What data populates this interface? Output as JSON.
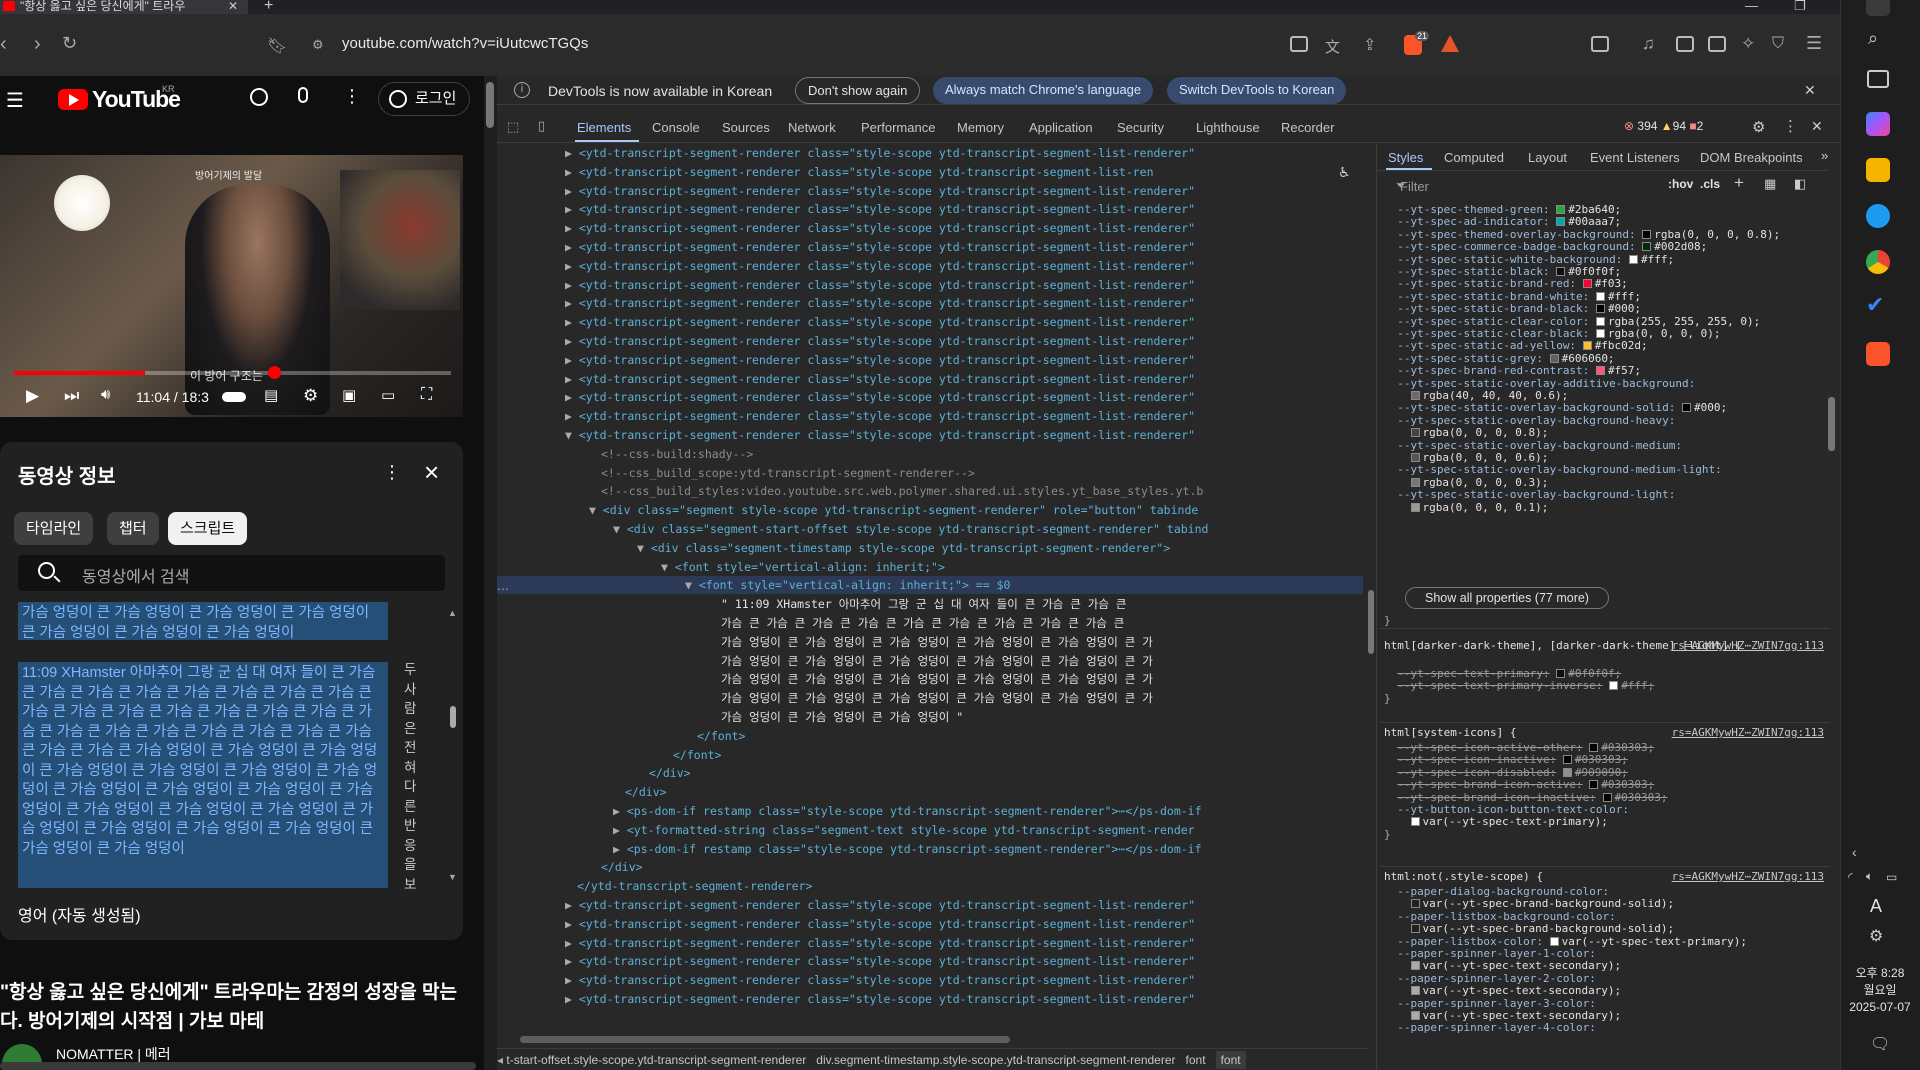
{
  "browser": {
    "tab_title": "\"항상 옳고 싶은 당신에게\" 트라우",
    "url": "youtube.com/watch?v=iUutcwcTGQs",
    "ext_badge": "21"
  },
  "youtube": {
    "logo_text": "YouTube",
    "logo_region": "KR",
    "login_label": "로그인",
    "video_overlay_text": "방어기제의 발달",
    "video_caption": "이 방어 구조는",
    "current_time": "11:04 / 18:3",
    "progress_fraction": 0.6,
    "panel_title": "동영상 정보",
    "chips": [
      "타임라인",
      "챕터",
      "스크립트"
    ],
    "selected_chip": "스크립트",
    "search_placeholder": "동영상에서 검색",
    "segment1_text": "가슴 엉덩이 큰 가슴 엉덩이 큰 가슴 엉덩이 큰 가슴 엉덩이 큰 가슴 엉덩이 큰 가슴 엉덩이 큰 가슴 엉덩이",
    "segment2_text": "11:09 XHamster 아마추어 그랑 군 십 대 여자 들이 큰 가슴 큰 가슴 큰 가슴 큰 가슴 큰 가슴 큰 가슴 큰 가슴 큰 가슴 큰 가슴 큰 가슴 큰 가슴 큰 가슴 큰 가슴 큰 가슴 큰 가슴 큰 가슴 큰 가슴 큰 가슴 큰 가슴 큰 가슴 큰 가슴 큰 가슴 큰 가슴 큰 가슴 큰 가슴 큰 가슴 엉덩이 큰 가슴 엉덩이 큰 가슴 엉덩이 큰 가슴 엉덩이 큰 가슴 엉덩이 큰 가슴 엉덩이 큰 가슴 엉덩이 큰 가슴 엉덩이 큰 가슴 엉덩이 큰 가슴 엉덩이 큰 가슴 엉덩이 큰 가슴 엉덩이 큰 가슴 엉덩이 큰 가슴 엉덩이 큰 가슴 엉덩이 큰 가슴 엉덩이 큰 가슴 엉덩이 큰 가슴 엉덩이 큰 가슴 엉덩이 큰 가슴 엉덩이",
    "vertical_text": "두사람은전혀다른반응을보",
    "language_label": "영어 (자동 생성됨)",
    "video_title": "\"항상 옳고 싶은 당신에게\" 트라우마는 감정의 성장을 막는다. 방어기제의 시작점 | 가보 마테",
    "channel_name": "NOMATTER | 메러"
  },
  "devtools": {
    "banner_text": "DevTools is now available in Korean",
    "banner_buttons": [
      "Don't show again",
      "Always match Chrome's language",
      "Switch DevTools to Korean"
    ],
    "tabs": [
      "Elements",
      "Console",
      "Sources",
      "Network",
      "Performance",
      "Memory",
      "Application",
      "Security",
      "Lighthouse",
      "Recorder"
    ],
    "selected_tab": "Elements",
    "error_count": "394",
    "warning_count": "94",
    "issue_count": "2",
    "tree_lines": [
      {
        "indent": 34,
        "caret": "▶",
        "type": "tag",
        "text": "<ytd-transcript-segment-renderer class=\"style-scope ytd-transcript-segment-list-renderer\""
      },
      {
        "indent": 34,
        "caret": "▶",
        "type": "tag",
        "text": "<ytd-transcript-segment-renderer class=\"style-scope ytd-transcript-segment-list-ren"
      },
      {
        "indent": 34,
        "caret": "▶",
        "type": "tag",
        "text": "<ytd-transcript-segment-renderer class=\"style-scope ytd-transcript-segment-list-renderer\""
      },
      {
        "indent": 34,
        "caret": "▶",
        "type": "tag",
        "text": "<ytd-transcript-segment-renderer class=\"style-scope ytd-transcript-segment-list-renderer\""
      },
      {
        "indent": 34,
        "caret": "▶",
        "type": "tag",
        "text": "<ytd-transcript-segment-renderer class=\"style-scope ytd-transcript-segment-list-renderer\""
      },
      {
        "indent": 34,
        "caret": "▶",
        "type": "tag",
        "text": "<ytd-transcript-segment-renderer class=\"style-scope ytd-transcript-segment-list-renderer\""
      },
      {
        "indent": 34,
        "caret": "▶",
        "type": "tag",
        "text": "<ytd-transcript-segment-renderer class=\"style-scope ytd-transcript-segment-list-renderer\""
      },
      {
        "indent": 34,
        "caret": "▶",
        "type": "tag",
        "text": "<ytd-transcript-segment-renderer class=\"style-scope ytd-transcript-segment-list-renderer\""
      },
      {
        "indent": 34,
        "caret": "▶",
        "type": "tag",
        "text": "<ytd-transcript-segment-renderer class=\"style-scope ytd-transcript-segment-list-renderer\""
      },
      {
        "indent": 34,
        "caret": "▶",
        "type": "tag",
        "text": "<ytd-transcript-segment-renderer class=\"style-scope ytd-transcript-segment-list-renderer\""
      },
      {
        "indent": 34,
        "caret": "▶",
        "type": "tag",
        "text": "<ytd-transcript-segment-renderer class=\"style-scope ytd-transcript-segment-list-renderer\""
      },
      {
        "indent": 34,
        "caret": "▶",
        "type": "tag",
        "text": "<ytd-transcript-segment-renderer class=\"style-scope ytd-transcript-segment-list-renderer\""
      },
      {
        "indent": 34,
        "caret": "▶",
        "type": "tag",
        "text": "<ytd-transcript-segment-renderer class=\"style-scope ytd-transcript-segment-list-renderer\""
      },
      {
        "indent": 34,
        "caret": "▶",
        "type": "tag",
        "text": "<ytd-transcript-segment-renderer class=\"style-scope ytd-transcript-segment-list-renderer\""
      },
      {
        "indent": 34,
        "caret": "▶",
        "type": "tag",
        "text": "<ytd-transcript-segment-renderer class=\"style-scope ytd-transcript-segment-list-renderer\""
      },
      {
        "indent": 34,
        "caret": "▼",
        "type": "tag",
        "text": "<ytd-transcript-segment-renderer class=\"style-scope ytd-transcript-segment-list-renderer\""
      },
      {
        "indent": 52,
        "caret": "",
        "type": "cm",
        "text": "<!--css-build:shady-->"
      },
      {
        "indent": 52,
        "caret": "",
        "type": "cm",
        "text": "<!--css_build_scope:ytd-transcript-segment-renderer-->"
      },
      {
        "indent": 52,
        "caret": "",
        "type": "cm",
        "text": "<!--css_build_styles:video.youtube.src.web.polymer.shared.ui.styles.yt_base_styles.yt.b"
      },
      {
        "indent": 46,
        "caret": "▼",
        "type": "tag",
        "text": "<div class=\"segment style-scope ytd-transcript-segment-renderer\" role=\"button\" tabinde"
      },
      {
        "indent": 58,
        "caret": "▼",
        "type": "tag",
        "text": "<div class=\"segment-start-offset style-scope ytd-transcript-segment-renderer\" tabind"
      },
      {
        "indent": 70,
        "caret": "▼",
        "type": "tag",
        "text": "<div class=\"segment-timestamp style-scope ytd-transcript-segment-renderer\">"
      },
      {
        "indent": 82,
        "caret": "▼",
        "type": "tag",
        "text": "<font style=\"vertical-align: inherit;\">"
      },
      {
        "indent": 94,
        "caret": "▼",
        "type": "tag",
        "text": "<font style=\"vertical-align: inherit;\"> == $0",
        "hl": true
      },
      {
        "indent": 112,
        "caret": "",
        "type": "tx",
        "text": "\" 11:09 XHamster 아마추어 그랑 군 십 대 여자 들이 큰 가슴 큰 가슴 큰"
      },
      {
        "indent": 112,
        "caret": "",
        "type": "tx",
        "text": "가슴 큰 가슴 큰 가슴 큰 가슴 큰 가슴 큰 가슴 큰 가슴 큰 가슴 큰 가슴 큰"
      },
      {
        "indent": 112,
        "caret": "",
        "type": "tx",
        "text": "가슴 엉덩이 큰 가슴 엉덩이 큰 가슴 엉덩이 큰 가슴 엉덩이 큰 가슴 엉덩이 큰 가"
      },
      {
        "indent": 112,
        "caret": "",
        "type": "tx",
        "text": "가슴 엉덩이 큰 가슴 엉덩이 큰 가슴 엉덩이 큰 가슴 엉덩이 큰 가슴 엉덩이 큰 가"
      },
      {
        "indent": 112,
        "caret": "",
        "type": "tx",
        "text": "가슴 엉덩이 큰 가슴 엉덩이 큰 가슴 엉덩이 큰 가슴 엉덩이 큰 가슴 엉덩이 큰 가"
      },
      {
        "indent": 112,
        "caret": "",
        "type": "tx",
        "text": "가슴 엉덩이 큰 가슴 엉덩이 큰 가슴 엉덩이 큰 가슴 엉덩이 큰 가슴 엉덩이 큰 가"
      },
      {
        "indent": 112,
        "caret": "",
        "type": "tx",
        "text": "가슴 엉덩이 큰 가슴 엉덩이 큰 가슴 엉덩이 \""
      },
      {
        "indent": 100,
        "caret": "",
        "type": "tag",
        "text": "</font>"
      },
      {
        "indent": 88,
        "caret": "",
        "type": "tag",
        "text": "</font>"
      },
      {
        "indent": 76,
        "caret": "",
        "type": "tag",
        "text": "</div>"
      },
      {
        "indent": 64,
        "caret": "",
        "type": "tag",
        "text": "</div>"
      },
      {
        "indent": 58,
        "caret": "▶",
        "type": "tag",
        "text": "<ps-dom-if restamp class=\"style-scope ytd-transcript-segment-renderer\">⋯</ps-dom-if"
      },
      {
        "indent": 58,
        "caret": "▶",
        "type": "tag",
        "text": "<yt-formatted-string class=\"segment-text style-scope ytd-transcript-segment-render"
      },
      {
        "indent": 58,
        "caret": "▶",
        "type": "tag",
        "text": "<ps-dom-if restamp class=\"style-scope ytd-transcript-segment-renderer\">⋯</ps-dom-if"
      },
      {
        "indent": 52,
        "caret": "",
        "type": "tag",
        "text": "</div>"
      },
      {
        "indent": 40,
        "caret": "",
        "type": "tag",
        "text": "</ytd-transcript-segment-renderer>"
      },
      {
        "indent": 34,
        "caret": "▶",
        "type": "tag",
        "text": "<ytd-transcript-segment-renderer class=\"style-scope ytd-transcript-segment-list-renderer\""
      },
      {
        "indent": 34,
        "caret": "▶",
        "type": "tag",
        "text": "<ytd-transcript-segment-renderer class=\"style-scope ytd-transcript-segment-list-renderer\""
      },
      {
        "indent": 34,
        "caret": "▶",
        "type": "tag",
        "text": "<ytd-transcript-segment-renderer class=\"style-scope ytd-transcript-segment-list-renderer\""
      },
      {
        "indent": 34,
        "caret": "▶",
        "type": "tag",
        "text": "<ytd-transcript-segment-renderer class=\"style-scope ytd-transcript-segment-list-renderer\""
      },
      {
        "indent": 34,
        "caret": "▶",
        "type": "tag",
        "text": "<ytd-transcript-segment-renderer class=\"style-scope ytd-transcript-segment-list-renderer\""
      },
      {
        "indent": 34,
        "caret": "▶",
        "type": "tag",
        "text": "<ytd-transcript-segment-renderer class=\"style-scope ytd-transcript-segment-list-renderer\""
      }
    ],
    "breadcrumb": [
      "t-start-offset.style-scope.ytd-transcript-segment-renderer",
      "div.segment-timestamp.style-scope.ytd-transcript-segment-renderer",
      "font",
      "font"
    ],
    "styles_tabs": [
      "Styles",
      "Computed",
      "Layout",
      "Event Listeners",
      "DOM Breakpoints"
    ],
    "filter_placeholder": "Filter",
    "filter_tools": [
      ":hov",
      ".cls"
    ],
    "show_all_label": "Show all properties (77 more)",
    "style_lines_top": [
      {
        "p": "--yt-spec-themed-green:",
        "v": "#2ba640;",
        "c": "#2ba640"
      },
      {
        "p": "--yt-spec-ad-indicator:",
        "v": "#00aaa7;",
        "c": "#00aaa7"
      },
      {
        "p": "--yt-spec-themed-overlay-background:",
        "v": "rgba(0, 0, 0, 0.8);",
        "c": "#000000"
      },
      {
        "p": "--yt-spec-commerce-badge-background:",
        "v": "#002d08;",
        "c": "#002d08"
      },
      {
        "p": "--yt-spec-static-white-background:",
        "v": "#fff;",
        "c": "#ffffff"
      },
      {
        "p": "--yt-spec-static-black:",
        "v": "#0f0f0f;",
        "c": "#0f0f0f"
      },
      {
        "p": "--yt-spec-static-brand-red:",
        "v": "#f03;",
        "c": "#ff0033"
      },
      {
        "p": "--yt-spec-static-brand-white:",
        "v": "#fff;",
        "c": "#ffffff"
      },
      {
        "p": "--yt-spec-static-brand-black:",
        "v": "#000;",
        "c": "#000000"
      },
      {
        "p": "--yt-spec-static-clear-color:",
        "v": "rgba(255, 255, 255, 0);",
        "c": "#ffffff"
      },
      {
        "p": "--yt-spec-static-clear-black:",
        "v": "rgba(0, 0, 0, 0);",
        "c": "#ffffff"
      },
      {
        "p": "--yt-spec-static-ad-yellow:",
        "v": "#fbc02d;",
        "c": "#fbc02d"
      },
      {
        "p": "--yt-spec-static-grey:",
        "v": "#606060;",
        "c": "#606060"
      },
      {
        "p": "--yt-spec-brand-red-contrast:",
        "v": "#f57;",
        "c": "#ff5577"
      },
      {
        "p": "--yt-spec-static-overlay-additive-background:",
        "v": "",
        "c": ""
      },
      {
        "p": "",
        "v": "rgba(40, 40, 40, 0.6);",
        "c": "#6a6a6a",
        "sub": true
      },
      {
        "p": "--yt-spec-static-overlay-background-solid:",
        "v": "#000;",
        "c": "#000000"
      },
      {
        "p": "--yt-spec-static-overlay-background-heavy:",
        "v": "",
        "c": ""
      },
      {
        "p": "",
        "v": "rgba(0, 0, 0, 0.8);",
        "c": "#444444",
        "sub": true
      },
      {
        "p": "--yt-spec-static-overlay-background-medium:",
        "v": "",
        "c": ""
      },
      {
        "p": "",
        "v": "rgba(0, 0, 0, 0.6);",
        "c": "#555555",
        "sub": true
      },
      {
        "p": "--yt-spec-static-overlay-background-medium-light:",
        "v": "",
        "c": ""
      },
      {
        "p": "",
        "v": "rgba(0, 0, 0, 0.3);",
        "c": "#777777",
        "sub": true
      },
      {
        "p": "--yt-spec-static-overlay-background-light:",
        "v": "",
        "c": ""
      },
      {
        "p": "",
        "v": "rgba(0, 0, 0, 0.1);",
        "c": "#999999",
        "sub": true
      }
    ],
    "rule1": {
      "selector": "html[darker-dark-theme], [darker-dark-theme] [light] {",
      "src": "rs=AGKMywHZ⋯ZWIN7gg:113",
      "lines": [
        {
          "p": "--yt-spec-text-primary:",
          "v": "#0f0f0f;",
          "c": "#0f0f0f",
          "strike": true
        },
        {
          "p": "--yt-spec-text-primary-inverse:",
          "v": "#fff;",
          "c": "#ffffff",
          "strike": true
        }
      ]
    },
    "rule2": {
      "selector": "html[system-icons] {",
      "src": "rs=AGKMywHZ⋯ZWIN7gg:113",
      "lines": [
        {
          "p": "--yt-spec-icon-active-other:",
          "v": "#030303;",
          "c": "#030303",
          "strike": true
        },
        {
          "p": "--yt-spec-icon-inactive:",
          "v": "#030303;",
          "c": "#030303",
          "strike": true
        },
        {
          "p": "--yt-spec-icon-disabled:",
          "v": "#909090;",
          "c": "#909090",
          "strike": true
        },
        {
          "p": "--yt-spec-brand-icon-active:",
          "v": "#030303;",
          "c": "#030303",
          "strike": true
        },
        {
          "p": "--yt-spec-brand-icon-inactive:",
          "v": "#030303;",
          "c": "#030303",
          "strike": true
        },
        {
          "p": "--yt-button-icon-button-text-color:",
          "v": "",
          "c": ""
        },
        {
          "p": "",
          "v": "var(--yt-spec-text-primary);",
          "c": "#ffffff",
          "sub": true
        }
      ]
    },
    "rule3": {
      "selector": "html:not(.style-scope) {",
      "src": "rs=AGKMywHZ⋯ZWIN7gg:113",
      "lines": [
        {
          "p": "--paper-dialog-background-color:",
          "v": "",
          "c": ""
        },
        {
          "p": "",
          "v": "var(--yt-spec-brand-background-solid);",
          "c": "#222222",
          "sub": true
        },
        {
          "p": "--paper-listbox-background-color:",
          "v": "",
          "c": ""
        },
        {
          "p": "",
          "v": "var(--yt-spec-brand-background-solid);",
          "c": "#222222",
          "sub": true
        },
        {
          "p": "--paper-listbox-color:",
          "v": "var(--yt-spec-text-primary);",
          "c": "#ffffff"
        },
        {
          "p": "--paper-spinner-layer-1-color:",
          "v": "",
          "c": ""
        },
        {
          "p": "",
          "v": "var(--yt-spec-text-secondary);",
          "c": "#aaaaaa",
          "sub": true
        },
        {
          "p": "--paper-spinner-layer-2-color:",
          "v": "",
          "c": ""
        },
        {
          "p": "",
          "v": "var(--yt-spec-text-secondary);",
          "c": "#aaaaaa",
          "sub": true
        },
        {
          "p": "--paper-spinner-layer-3-color:",
          "v": "",
          "c": ""
        },
        {
          "p": "",
          "v": "var(--yt-spec-text-secondary);",
          "c": "#aaaaaa",
          "sub": true
        },
        {
          "p": "--paper-spinner-layer-4-color:",
          "v": "",
          "c": ""
        }
      ]
    }
  },
  "system": {
    "ime_label": "A",
    "time": "오후 8:28",
    "weekday": "월요일",
    "date": "2025-07-07"
  }
}
